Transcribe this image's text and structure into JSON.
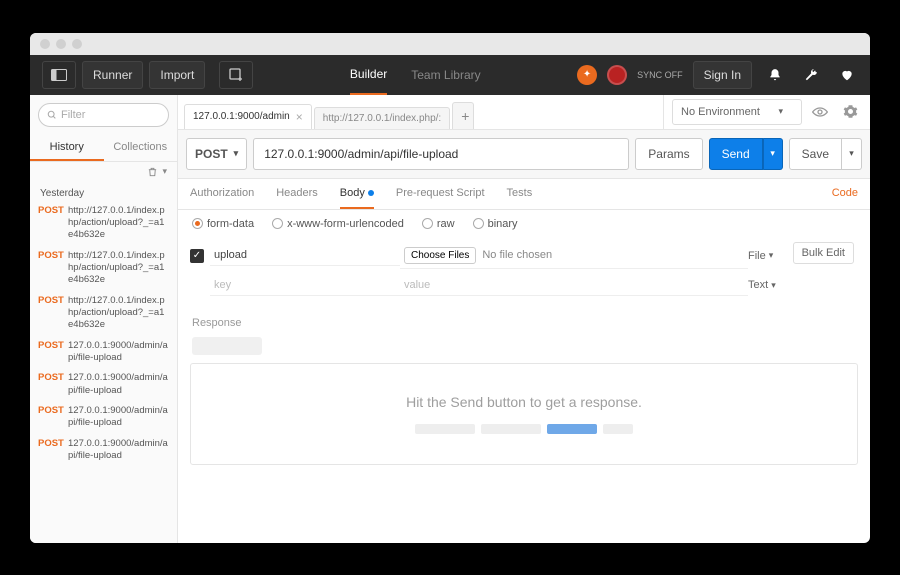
{
  "topbar": {
    "runner": "Runner",
    "import": "Import",
    "builder": "Builder",
    "teamlib": "Team Library",
    "sync": "SYNC OFF",
    "signin": "Sign In"
  },
  "sidebar": {
    "filter_placeholder": "Filter",
    "tab_history": "History",
    "tab_collections": "Collections",
    "group_label": "Yesterday",
    "items": [
      {
        "method": "POST",
        "url": "http://127.0.0.1/index.php/action/upload?_=a1e4b632e"
      },
      {
        "method": "POST",
        "url": "http://127.0.0.1/index.php/action/upload?_=a1e4b632e"
      },
      {
        "method": "POST",
        "url": "http://127.0.0.1/index.php/action/upload?_=a1e4b632e"
      },
      {
        "method": "POST",
        "url": "127.0.0.1:9000/admin/api/file-upload"
      },
      {
        "method": "POST",
        "url": "127.0.0.1:9000/admin/api/file-upload"
      },
      {
        "method": "POST",
        "url": "127.0.0.1:9000/admin/api/file-upload"
      },
      {
        "method": "POST",
        "url": "127.0.0.1:9000/admin/api/file-upload"
      }
    ]
  },
  "tabs": [
    {
      "label": "127.0.0.1:9000/admin",
      "active": true
    },
    {
      "label": "http://127.0.0.1/index.php/:",
      "active": false
    }
  ],
  "env": {
    "label": "No Environment"
  },
  "request": {
    "method": "POST",
    "url": "127.0.0.1:9000/admin/api/file-upload",
    "params_btn": "Params",
    "send_btn": "Send",
    "save_btn": "Save"
  },
  "subtabs": {
    "auth": "Authorization",
    "headers": "Headers",
    "body": "Body",
    "prereq": "Pre-request Script",
    "tests": "Tests",
    "code": "Code"
  },
  "body_types": {
    "formdata": "form-data",
    "urlenc": "x-www-form-urlencoded",
    "raw": "raw",
    "binary": "binary"
  },
  "kv": {
    "row0_key": "upload",
    "choose_files": "Choose Files",
    "no_file": "No file chosen",
    "type_file": "File",
    "type_text": "Text",
    "ph_key": "key",
    "ph_value": "value",
    "bulk_edit": "Bulk Edit"
  },
  "response": {
    "label": "Response",
    "hint": "Hit the Send button to get a response."
  }
}
